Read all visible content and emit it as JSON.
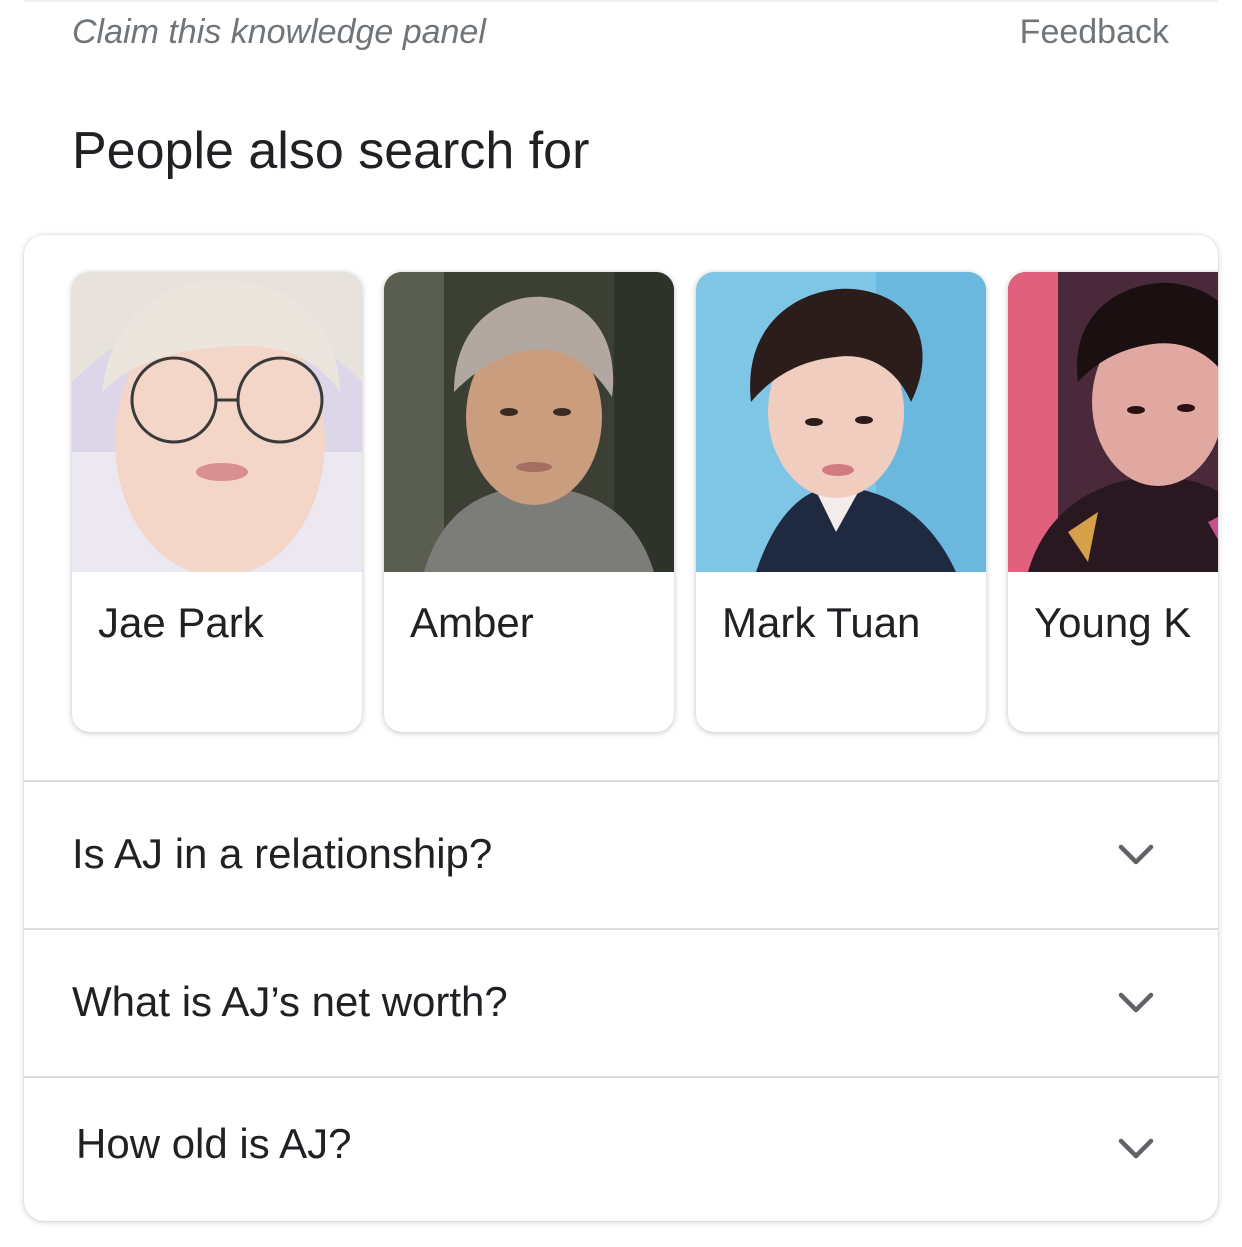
{
  "knowledge_panel": {
    "claim_label": "Claim this knowledge panel",
    "feedback_label": "Feedback"
  },
  "people_also_search": {
    "title": "People also search for",
    "people": [
      {
        "name": "Jae Park",
        "icon": "person-photo"
      },
      {
        "name": "Amber",
        "icon": "person-photo"
      },
      {
        "name": "Mark Tuan",
        "icon": "person-photo"
      },
      {
        "name": "Young K",
        "icon": "person-photo"
      }
    ]
  },
  "questions": [
    {
      "text": "Is AJ in a relationship?",
      "icon": "chevron-down-icon"
    },
    {
      "text": "What is AJ’s net worth?",
      "icon": "chevron-down-icon"
    },
    {
      "text": "How old is AJ?",
      "icon": "chevron-down-icon"
    }
  ],
  "colors": {
    "secondary_text": "#70757a",
    "primary_text": "#202124",
    "divider": "#dadce0"
  }
}
